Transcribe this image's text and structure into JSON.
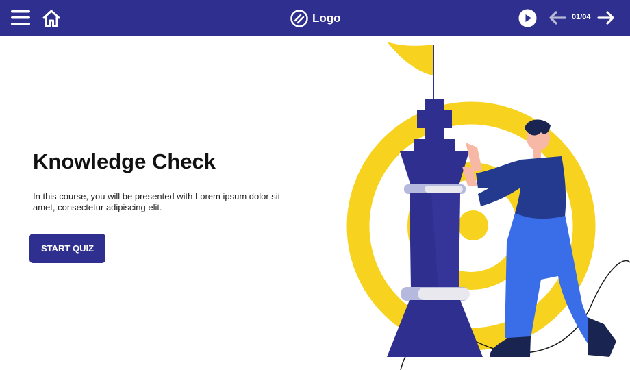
{
  "header": {
    "logo_text": "Logo",
    "page_indicator": "01/04",
    "icons": [
      "menu-icon",
      "home-icon",
      "logo-icon",
      "play-icon",
      "arrow-left-icon",
      "arrow-right-icon"
    ]
  },
  "main": {
    "title": "Knowledge Check",
    "description": "In this course, you will be presented with Lorem ipsum dolor sit amet, consectetur adipiscing elit.",
    "start_button_label": "START QUIZ"
  },
  "colors": {
    "header_bg": "#2f2f8f",
    "accent_yellow": "#f7d21e",
    "chess_piece": "#2f2f8f",
    "figure_pants": "#3a6de8",
    "figure_shirt": "#233a8f"
  }
}
